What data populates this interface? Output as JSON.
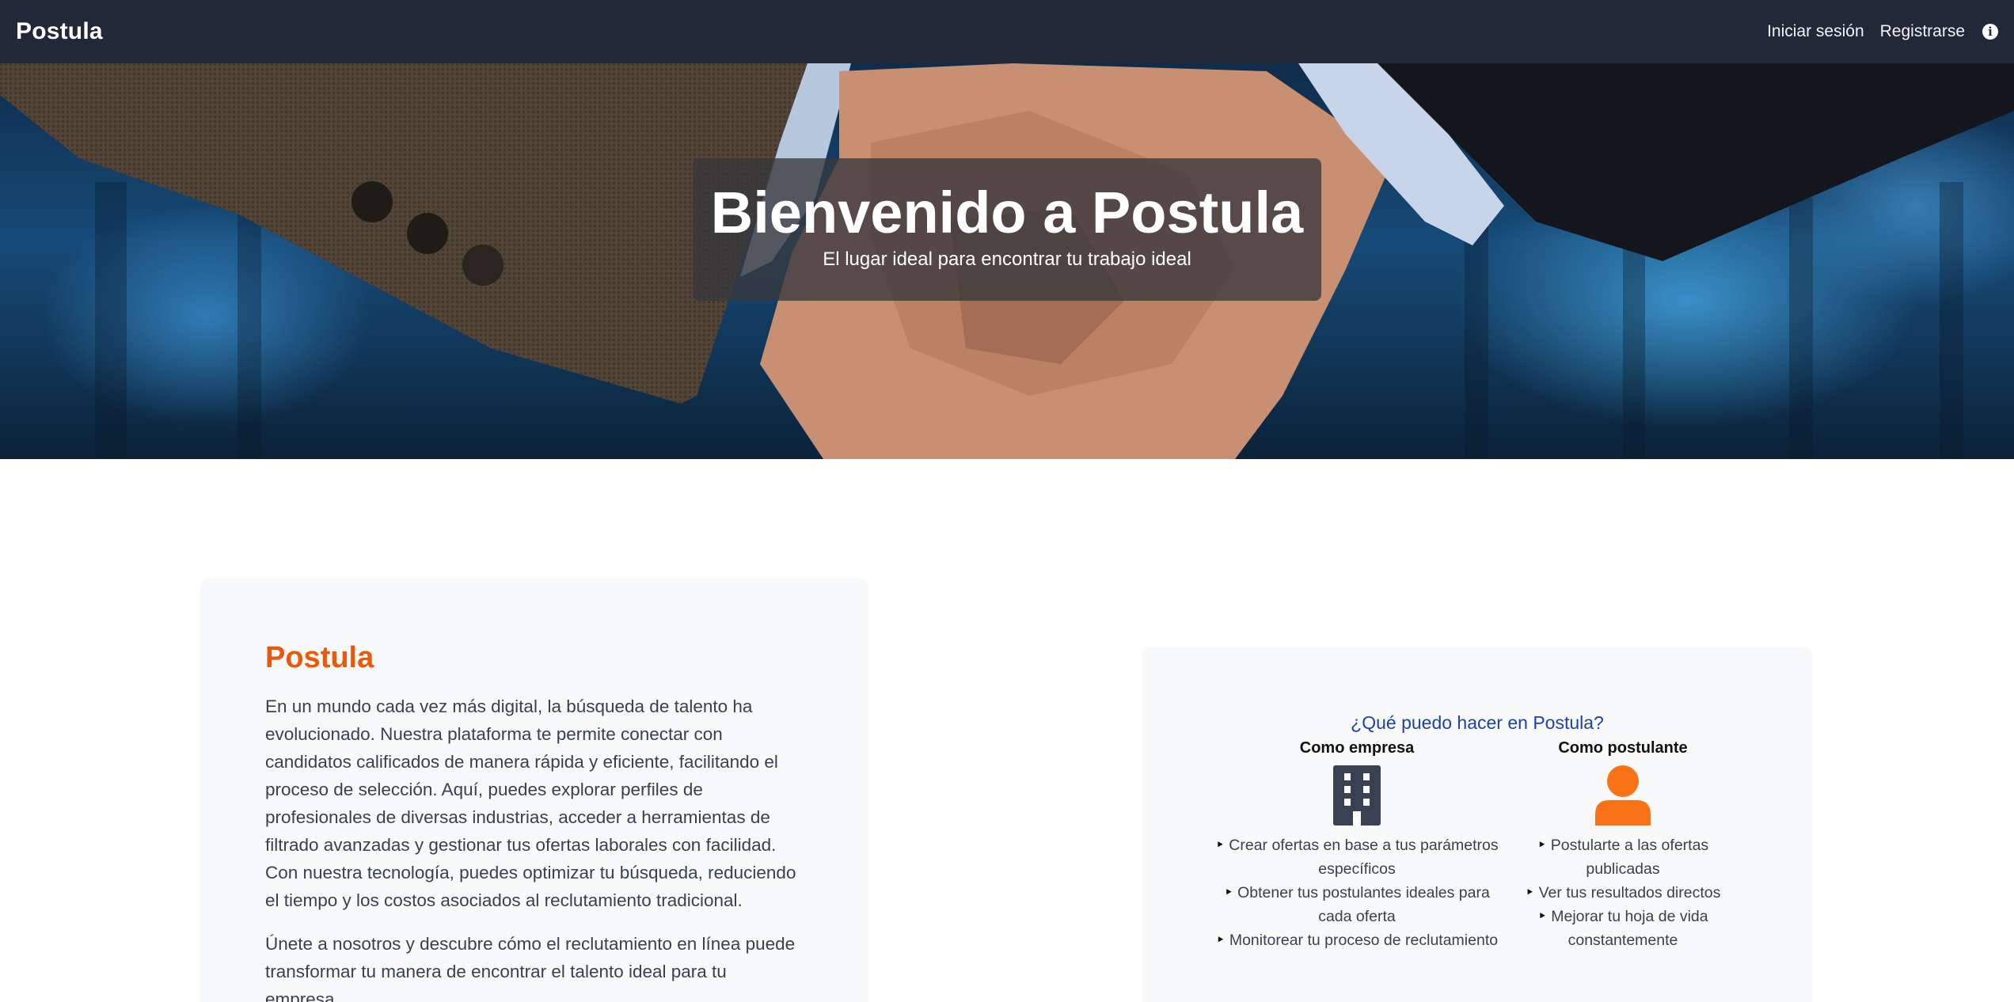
{
  "navbar": {
    "brand": "Postula",
    "login": "Iniciar sesión",
    "register": "Registrarse",
    "info_icon": "info-circle-icon"
  },
  "hero": {
    "title": "Bienvenido a Postula",
    "subtitle": "El lugar ideal para encontrar tu trabajo ideal"
  },
  "about": {
    "title": "Postula",
    "paragraph1": "En un mundo cada vez más digital, la búsqueda de talento ha evolucionado. Nuestra plataforma te permite conectar con candidatos calificados de manera rápida y eficiente, facilitando el proceso de selección. Aquí, puedes explorar perfiles de profesionales de diversas industrias, acceder a herramientas de filtrado avanzadas y gestionar tus ofertas laborales con facilidad. Con nuestra tecnología, puedes optimizar tu búsqueda, reduciendo el tiempo y los costos asociados al reclutamiento tradicional.",
    "paragraph2": "Únete a nosotros y descubre cómo el reclutamiento en línea puede transformar tu manera de encontrar el talento ideal para tu empresa."
  },
  "features": {
    "title": "¿Qué puedo hacer en Postula?",
    "empresa": {
      "heading": "Como empresa",
      "icon": "building-icon",
      "items": [
        "Crear ofertas en base a tus parámetros específicos",
        "Obtener tus postulantes ideales para cada oferta",
        "Monitorear tu proceso de reclutamiento"
      ]
    },
    "postulante": {
      "heading": "Como postulante",
      "icon": "user-icon",
      "items": [
        "Postularte a las ofertas publicadas",
        "Ver tus resultados directos",
        "Mejorar tu hoja de vida constantemente"
      ]
    }
  },
  "colors": {
    "navbar": "#1f2937",
    "accent_orange": "#ea580c",
    "title_blue": "#1e40af",
    "card_bg": "#f8f9fa"
  }
}
